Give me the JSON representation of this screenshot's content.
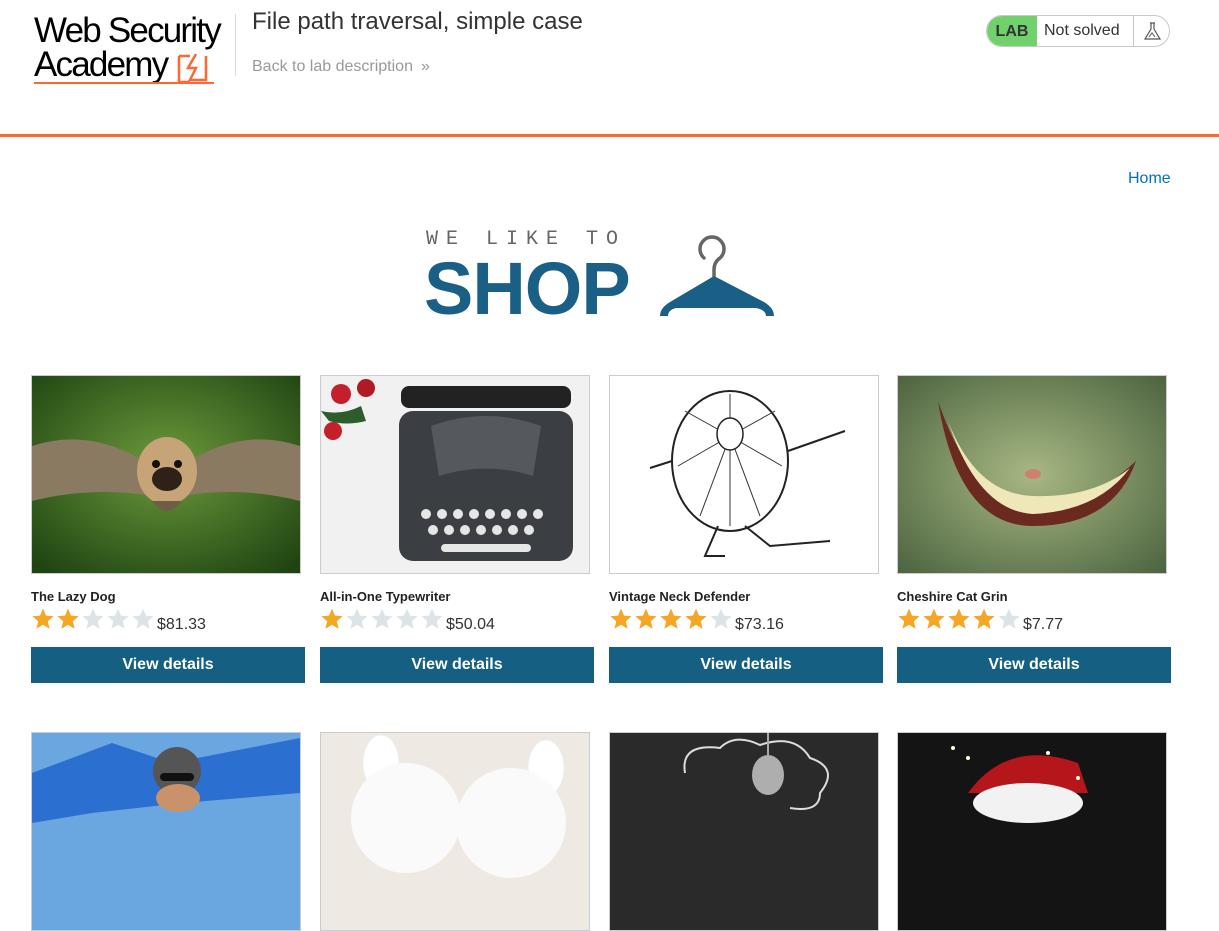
{
  "header": {
    "logo_line1": "Web Security",
    "logo_line2": "Academy",
    "lab_title": "File path traversal, simple case",
    "back_link": "Back to lab description",
    "status_lab": "LAB",
    "status_text": "Not solved"
  },
  "nav": {
    "home": "Home"
  },
  "banner": {
    "top": "WE LIKE TO",
    "main": "SHOP"
  },
  "colors": {
    "accent": "#ff6633",
    "brand": "#145f82",
    "lab_green": "#70d16d",
    "star": "#f5a623",
    "star_empty": "#dde4e8"
  },
  "products": [
    {
      "name": "The Lazy Dog",
      "rating": 2,
      "price": "$81.33",
      "button": "View details"
    },
    {
      "name": "All-in-One Typewriter",
      "rating": 1,
      "price": "$50.04",
      "button": "View details"
    },
    {
      "name": "Vintage Neck Defender",
      "rating": 4,
      "price": "$73.16",
      "button": "View details"
    },
    {
      "name": "Cheshire Cat Grin",
      "rating": 4,
      "price": "$7.77",
      "button": "View details"
    }
  ]
}
